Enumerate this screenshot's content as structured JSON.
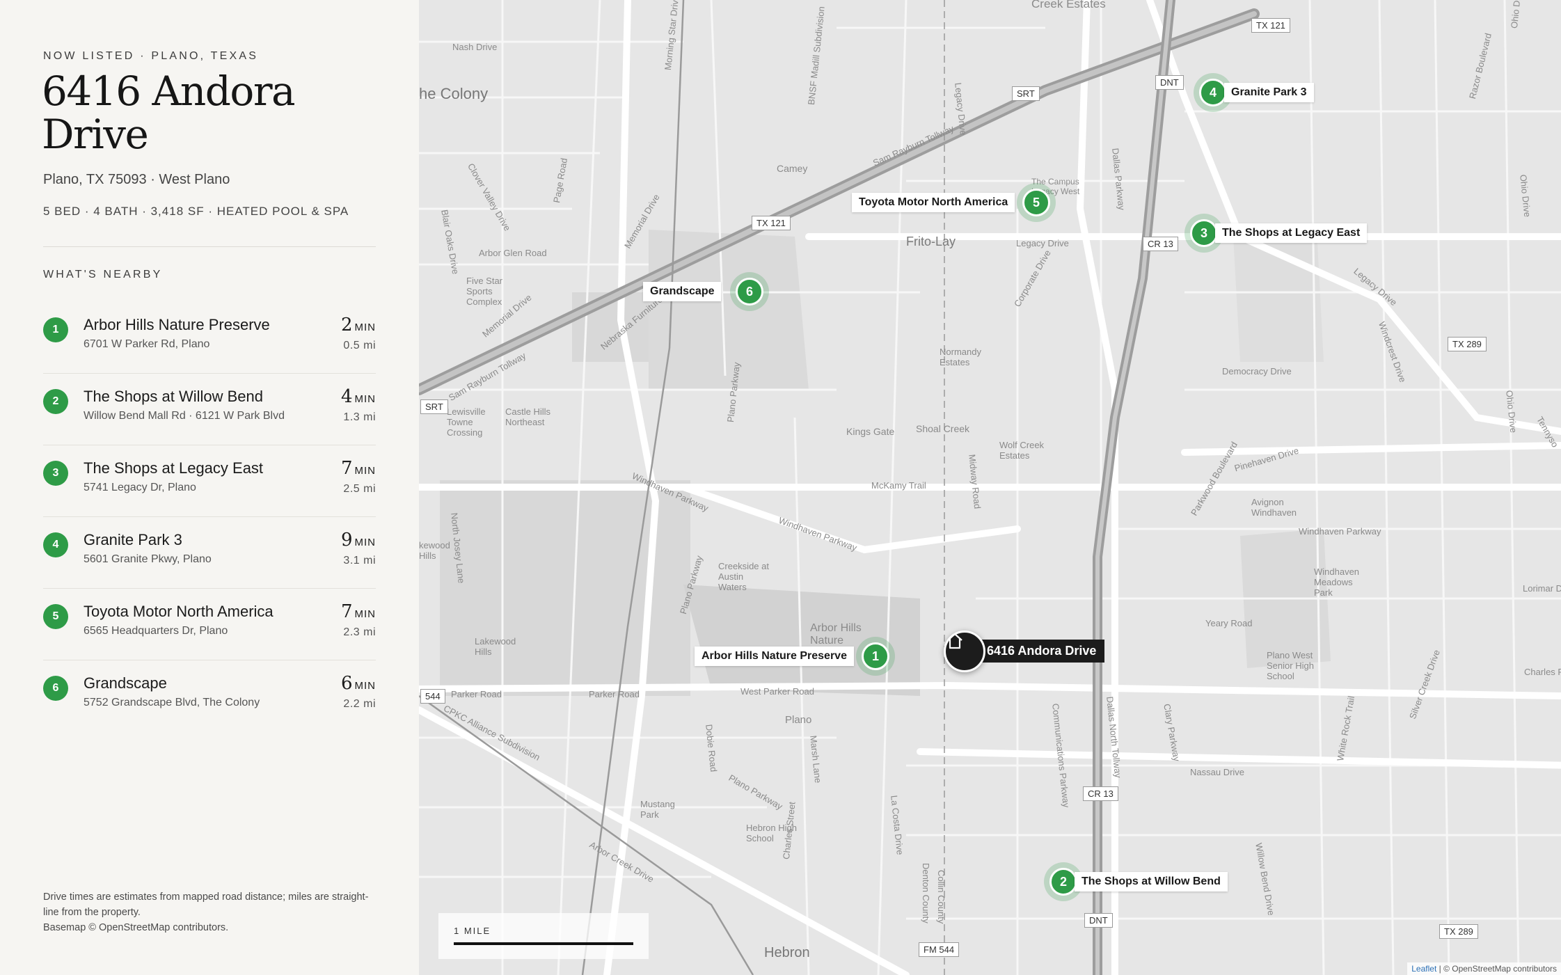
{
  "panel": {
    "eyebrow": "NOW LISTED · PLANO, TEXAS",
    "title": "6416 Andora Drive",
    "subline": "Plano, TX 75093 · West Plano",
    "specs": "5 BED · 4 BATH · 3,418 SF · HEATED POOL & SPA",
    "nearby_heading": "WHAT'S NEARBY",
    "footnote_1": "Drive times are estimates from mapped road distance; miles are straight-line from the property.",
    "footnote_2": "Basemap © OpenStreetMap contributors."
  },
  "pois": [
    {
      "num": "1",
      "name": "Arbor Hills Nature Preserve",
      "address": "6701 W Parker Rd, Plano",
      "time": "2",
      "unit": "MIN",
      "distance": "0.5 mi"
    },
    {
      "num": "2",
      "name": "The Shops at Willow Bend",
      "address": "Willow Bend Mall Rd · 6121 W Park Blvd",
      "time": "4",
      "unit": "MIN",
      "distance": "1.3 mi"
    },
    {
      "num": "3",
      "name": "The Shops at Legacy East",
      "address": "5741 Legacy Dr, Plano",
      "time": "7",
      "unit": "MIN",
      "distance": "2.5 mi"
    },
    {
      "num": "4",
      "name": "Granite Park 3",
      "address": "5601 Granite Pkwy, Plano",
      "time": "9",
      "unit": "MIN",
      "distance": "3.1 mi"
    },
    {
      "num": "5",
      "name": "Toyota Motor North America",
      "address": "6565 Headquarters Dr, Plano",
      "time": "7",
      "unit": "MIN",
      "distance": "2.3 mi"
    },
    {
      "num": "6",
      "name": "Grandscape",
      "address": "5752 Grandscape Blvd, The Colony",
      "time": "6",
      "unit": "MIN",
      "distance": "2.2 mi"
    }
  ],
  "map": {
    "home_label": "6416 Andora Drive",
    "home_icon": "house-icon",
    "scale_label": "1 MILE",
    "attribution_leaflet": "Leaflet",
    "attribution_osm": "| © OpenStreetMap contributors",
    "marker_color": "#2e9b47",
    "home_color": "#1c1c1c",
    "places": {
      "creek_estates": "Creek Estates",
      "colony": "he Colony",
      "camey": "Camey",
      "frito_lay": "Frito-Lay",
      "campus": "The Campus Legacy West",
      "five_star": "Five Star Sports Complex",
      "normandy": "Normandy Estates",
      "kings_gate": "Kings Gate",
      "shoal_creek": "Shoal Creek",
      "wolf_creek": "Wolf Creek Estates",
      "lewisville": "Lewisville Towne Crossing",
      "castle_hills": "Castle Hills Northeast",
      "creekside": "Creekside at Austin Waters",
      "arbor_hills": "Arbor Hills Nature",
      "lakewood": "Lakewood Hills",
      "plano": "Plano",
      "mustang": "Mustang Park",
      "hebron_hs": "Hebron High School",
      "hebron": "Hebron",
      "avignon": "Avignon Windhaven",
      "windhaven_meadows": "Windhaven Meadows Park",
      "plano_west": "Plano West Senior High School",
      "kewood": "kewood Hills"
    },
    "roads": {
      "nash": "Nash Drive",
      "legacy_dr": "Legacy Drive",
      "legacy_dr2": "Legacy Drive",
      "sam_rayburn": "Sam Rayburn Tollway",
      "sam_rayburn2": "Sam Rayburn Tollway",
      "arbor_glen": "Arbor Glen Road",
      "morning_star": "Morning Star Drive",
      "bnsf": "BNSF Madill Subdivision",
      "page": "Page Road",
      "memorial": "Memorial Drive",
      "memorial2": "Memorial Drive",
      "clover": "Clover Valley Drive",
      "blair_oaks": "Blair Oaks Drive",
      "nebraska": "Nebraska Furniture",
      "corporate": "Corporate Drive",
      "dallas_pkwy": "Dallas Parkway",
      "democracy": "Democracy Drive",
      "pinehaven": "Pinehaven Drive",
      "parkwood": "Parkwood Boulevard",
      "windhaven_pkwy": "Windhaven Parkway",
      "windhaven_pkwy2": "Windhaven Parkway",
      "windhaven_pkwy3": "Windhaven Parkway",
      "mckamy": "McKamy Trail",
      "midway": "Midway Road",
      "north_josey": "North Josey Lane",
      "plano_pkwy": "Plano Parkway",
      "plano_pkwy2": "Plano Parkway",
      "plano_pkwy3": "Plano Parkway",
      "parker": "Parker Road",
      "parker2": "Parker Road",
      "west_parker": "West Parker Road",
      "cpkc": "CPKC Alliance Subdivision",
      "dallas_north_tollway": "Dallas North Tollway",
      "communications": "Communications Parkway",
      "nassau": "Nassau Drive",
      "yeary": "Yeary Road",
      "clary": "Clary Parkway",
      "willow_bend": "Willow Bend Drive",
      "white_rock": "White Rock Trail",
      "silver_creek": "Silver Creek Drive",
      "charles_place": "Charles Place",
      "lorimar": "Lorimar Dri",
      "ohio": "Ohio Drive",
      "ohio2": "Ohio Drive",
      "ohio3": "Ohio Drive",
      "marsh": "Marsh Lane",
      "la_costa": "La Costa Drive",
      "arbor_creek": "Arbor Creek Drive",
      "charles": "Charles Street",
      "denton": "Denton County",
      "collin": "Collin County",
      "tennyson": "Tennyso",
      "razor": "Razor Boulevard",
      "dobie": "Dobie Road",
      "windcrest": "Windcrest Drive",
      "legacy_dr3": "Legacy Drive"
    },
    "shields": {
      "tx121_a": "TX 121",
      "tx121_b": "TX 121",
      "dnt_a": "DNT",
      "dnt_b": "DNT",
      "srt_a": "SRT",
      "srt_b": "SRT",
      "cr13_a": "CR 13",
      "cr13_b": "CR 13",
      "tx289_a": "TX 289",
      "tx289_b": "TX 289",
      "fm544_a": "544",
      "fm544_b": "FM 544"
    },
    "markers": [
      {
        "num": "1",
        "label": "Arbor Hills Nature Preserve"
      },
      {
        "num": "2",
        "label": "The Shops at Willow Bend"
      },
      {
        "num": "3",
        "label": "The Shops at Legacy East"
      },
      {
        "num": "4",
        "label": "Granite Park 3"
      },
      {
        "num": "5",
        "label": "Toyota Motor North America"
      },
      {
        "num": "6",
        "label": "Grandscape"
      }
    ]
  }
}
